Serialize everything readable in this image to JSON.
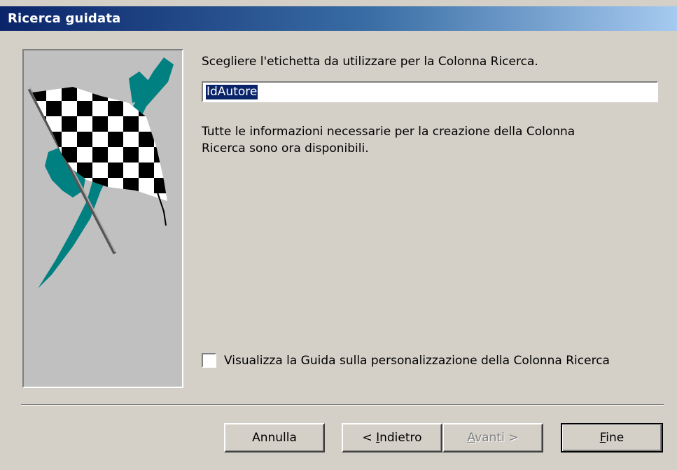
{
  "window": {
    "title": "Ricerca guidata"
  },
  "prompt": "Scegliere l'etichetta da utilizzare per la Colonna Ricerca.",
  "label_field": {
    "value": "IdAutore"
  },
  "info_text": [
    "Tutte le informazioni necessarie per la creazione della Colonna",
    "Ricerca sono ora disponibili."
  ],
  "help_checkbox": {
    "label": "Visualizza la Guida sulla personalizzazione della Colonna Ricerca",
    "checked": false
  },
  "buttons": {
    "cancel": "Annulla",
    "back": {
      "prefix": "< ",
      "mnemonic": "I",
      "rest": "ndietro"
    },
    "next": {
      "mnemonic": "A",
      "rest": "vanti >",
      "disabled": true
    },
    "finish": {
      "mnemonic": "F",
      "rest": "ine"
    }
  },
  "colors": {
    "title_start": "#0a246a",
    "title_end": "#a6caf0",
    "teal": "#008080",
    "face": "#d4d0c8"
  },
  "icons": [
    "checkered-flag-icon"
  ]
}
